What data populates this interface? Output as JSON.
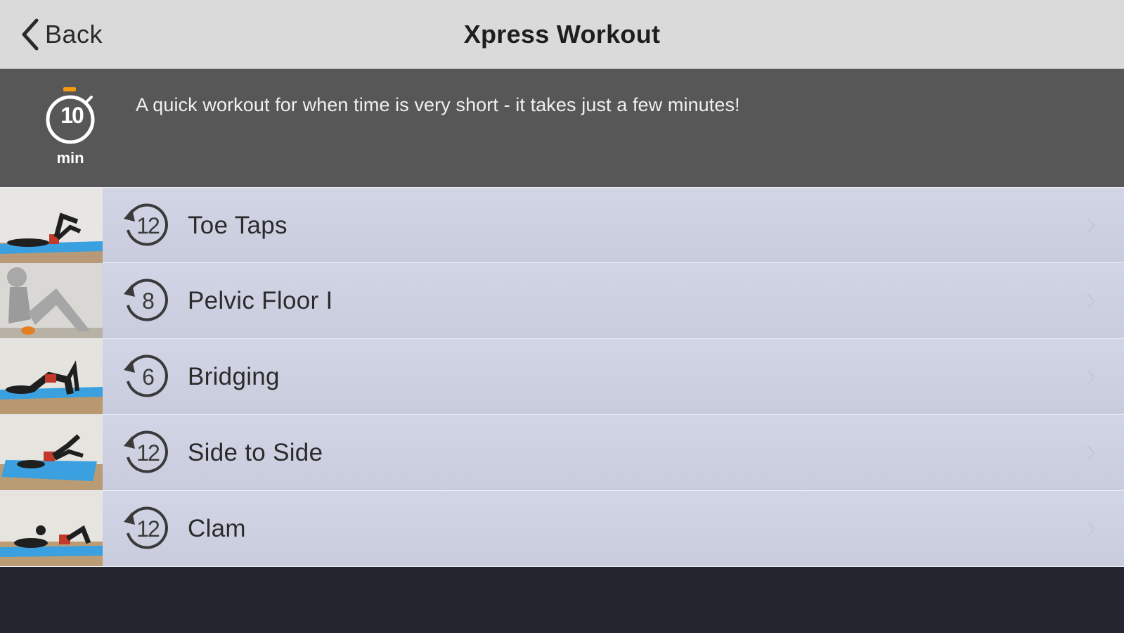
{
  "navbar": {
    "back_label": "Back",
    "title": "Xpress Workout"
  },
  "info": {
    "duration_value": "10",
    "duration_unit": "min",
    "description": "A quick workout for when time is very short - it takes just a few minutes!"
  },
  "exercises": [
    {
      "reps": "12",
      "name": "Toe Taps",
      "thumbnail": "toe-taps-thumbnail"
    },
    {
      "reps": "8",
      "name": "Pelvic Floor I",
      "thumbnail": "pelvic-floor-thumbnail"
    },
    {
      "reps": "6",
      "name": "Bridging",
      "thumbnail": "bridging-thumbnail"
    },
    {
      "reps": "12",
      "name": "Side to Side",
      "thumbnail": "side-to-side-thumbnail"
    },
    {
      "reps": "12",
      "name": "Clam",
      "thumbnail": "clam-thumbnail"
    }
  ],
  "colors": {
    "navbar_bg": "#dadada",
    "info_bg": "#575757",
    "row_bg": "#d2d5e6",
    "footer_bg": "#23252f",
    "mat_blue": "#3aa0e0",
    "accent_orange": "#f39c12"
  },
  "icons": {
    "back": "chevron-left-icon",
    "timer": "stopwatch-icon",
    "reps": "repeat-icon",
    "row_chevron": "chevron-right-icon"
  }
}
